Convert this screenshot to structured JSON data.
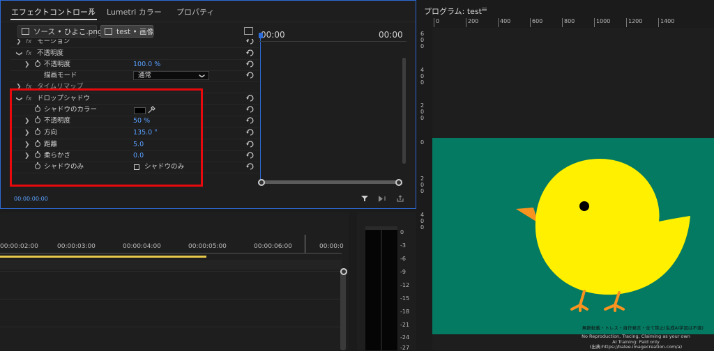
{
  "effect_controls": {
    "tabs": [
      {
        "label": "エフェクトコントロール",
        "menu": "≡"
      },
      {
        "label": "Lumetri カラー"
      },
      {
        "label": "プロパティ"
      }
    ],
    "source_clip": "ソース • ひよこ.png",
    "sequence_clip": "test • 画像",
    "timecode_start": "00:00",
    "timecode_end": "00:00",
    "current_time": "00:00:00:00",
    "rows": {
      "motion": "モーション",
      "opacity": "不透明度",
      "opacity_prop": "不透明度",
      "opacity_value": "100.0 %",
      "blend_mode": "描画モード",
      "blend_value": "通常",
      "time_remap": "タイムリマップ",
      "drop_shadow": "ドロップシャドウ",
      "shadow_color": "シャドウのカラー",
      "ds_opacity": "不透明度",
      "ds_opacity_value": "50 %",
      "direction": "方向",
      "direction_value": "135.0 °",
      "distance": "距離",
      "distance_value": "5.0",
      "softness": "柔らかさ",
      "softness_value": "0.0",
      "shadow_only": "シャドウのみ",
      "shadow_only_checkbox_label": "シャドウのみ"
    },
    "colors": {
      "shadow_swatch": "#000000",
      "highlight": "#e8090d",
      "accent": "#5aa0ff"
    }
  },
  "program_monitor": {
    "title": "プログラム: test",
    "menu": "≡",
    "ruler_top": [
      "0",
      "200",
      "400",
      "600",
      "800",
      "1000",
      "1200",
      "1400"
    ],
    "ruler_left": [
      [
        "6",
        "0",
        "0"
      ],
      [
        "4",
        "0",
        "0"
      ],
      [
        "2",
        "0",
        "0"
      ],
      [
        "0"
      ],
      [
        "2",
        "0",
        "0"
      ],
      [
        "4",
        "0",
        "0"
      ]
    ],
    "watermark_lines": [
      "無断転載・トレス・自作発言・全て禁止(生成AI学習は不適)",
      "No Reproduction, Tracing, Claiming as your own",
      "AI Training: Paid only",
      "(出典:https://balee.imagecreation.com/a)"
    ],
    "colors": {
      "background": "#047a62",
      "chick_body": "#fff000",
      "beak": "#f7931e",
      "legs": "#f7931e"
    }
  },
  "timeline": {
    "timecodes": [
      "00:00:02:00",
      "00:00:03:00",
      "00:00:04:00",
      "00:00:05:00",
      "00:00:06:00",
      "00:00:0"
    ]
  },
  "audio_meter": {
    "db_labels": [
      "0",
      "-3",
      "-6",
      "-9",
      "-12",
      "-15",
      "-18",
      "-21",
      "-24",
      "-27"
    ]
  }
}
